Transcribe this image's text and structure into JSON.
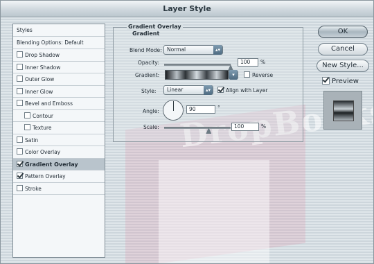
{
  "window": {
    "title": "Layer Style"
  },
  "watermark": {
    "text": "DropBooks"
  },
  "styles_list": {
    "items": [
      {
        "label": "Styles",
        "type": "header",
        "checked": null,
        "selected": false
      },
      {
        "label": "Blending Options: Default",
        "type": "header",
        "checked": null,
        "selected": false
      },
      {
        "label": "Drop Shadow",
        "type": "item",
        "checked": false,
        "selected": false
      },
      {
        "label": "Inner Shadow",
        "type": "item",
        "checked": false,
        "selected": false
      },
      {
        "label": "Outer Glow",
        "type": "item",
        "checked": false,
        "selected": false
      },
      {
        "label": "Inner Glow",
        "type": "item",
        "checked": false,
        "selected": false
      },
      {
        "label": "Bevel and Emboss",
        "type": "item",
        "checked": false,
        "selected": false
      },
      {
        "label": "Contour",
        "type": "sub",
        "checked": false,
        "selected": false
      },
      {
        "label": "Texture",
        "type": "sub",
        "checked": false,
        "selected": false
      },
      {
        "label": "Satin",
        "type": "item",
        "checked": false,
        "selected": false
      },
      {
        "label": "Color Overlay",
        "type": "item",
        "checked": false,
        "selected": false
      },
      {
        "label": "Gradient Overlay",
        "type": "item",
        "checked": true,
        "selected": true
      },
      {
        "label": "Pattern Overlay",
        "type": "item",
        "checked": true,
        "selected": false
      },
      {
        "label": "Stroke",
        "type": "item",
        "checked": false,
        "selected": false
      }
    ]
  },
  "panel": {
    "group_title": "Gradient Overlay",
    "group_subtitle": "Gradient",
    "blend_mode": {
      "label": "Blend Mode:",
      "value": "Normal"
    },
    "opacity": {
      "label": "Opacity:",
      "value": "100",
      "unit": "%",
      "level": 1.0
    },
    "gradient": {
      "label": "Gradient:",
      "reverse_label": "Reverse",
      "reverse_checked": false
    },
    "style": {
      "label": "Style:",
      "value": "Linear",
      "align_label": "Align with Layer",
      "align_checked": true
    },
    "angle": {
      "label": "Angle:",
      "value": "90",
      "unit": "°"
    },
    "scale": {
      "label": "Scale:",
      "value": "100",
      "unit": "%",
      "level": 0.67
    }
  },
  "buttons": {
    "ok": "OK",
    "cancel": "Cancel",
    "new_style": "New Style...",
    "preview_label": "Preview",
    "preview_checked": true
  }
}
